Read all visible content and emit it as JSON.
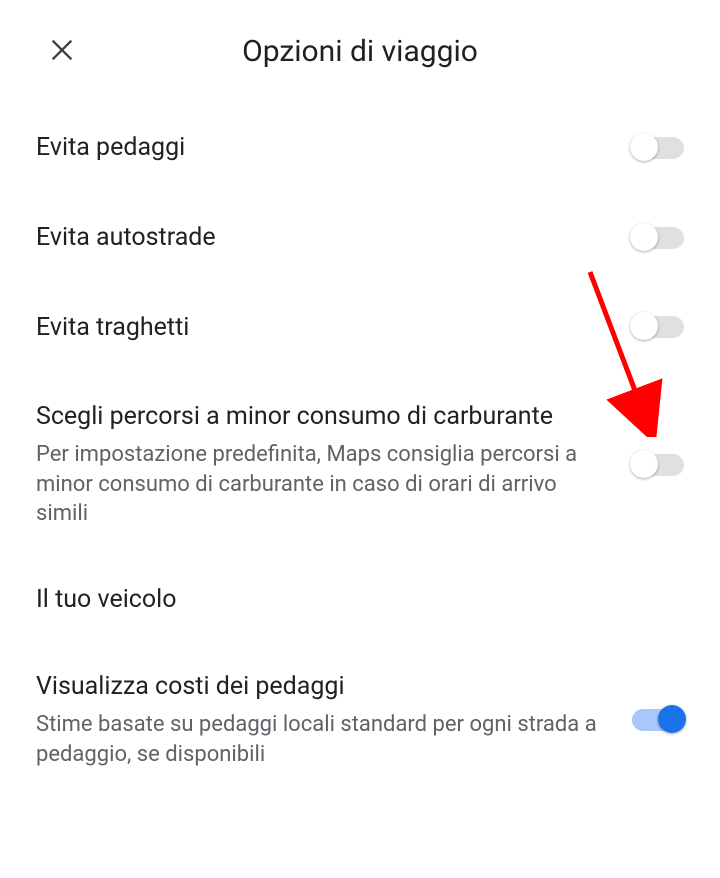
{
  "header": {
    "title": "Opzioni di viaggio"
  },
  "settings": {
    "avoid_tolls": {
      "label": "Evita pedaggi",
      "enabled": false
    },
    "avoid_highways": {
      "label": "Evita autostrade",
      "enabled": false
    },
    "avoid_ferries": {
      "label": "Evita traghetti",
      "enabled": false
    },
    "fuel_efficient": {
      "label": "Scegli percorsi a minor consumo di carburante",
      "description": "Per impostazione predefinita, Maps consiglia percorsi a minor consumo di carburante in caso di orari di arrivo simili",
      "enabled": false
    },
    "vehicle_section": {
      "label": "Il tuo veicolo"
    },
    "toll_costs": {
      "label": "Visualizza costi dei pedaggi",
      "description": "Stime basate su pedaggi locali standard per ogni strada a pedaggio, se disponibili",
      "enabled": true
    }
  },
  "annotation": {
    "arrow_color": "#ff0000"
  }
}
